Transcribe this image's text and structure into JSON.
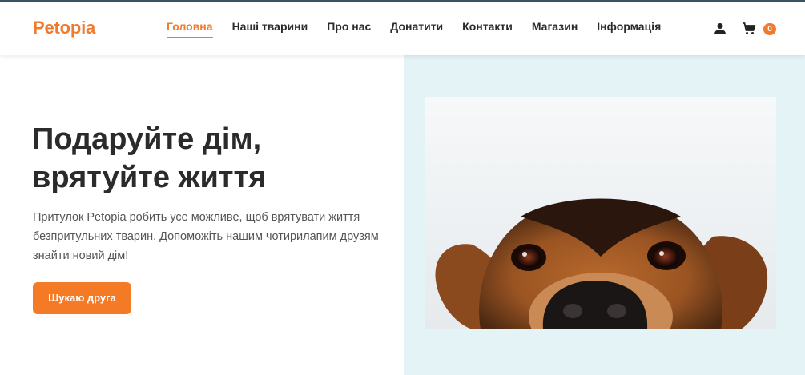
{
  "brand": {
    "name": "Petopia",
    "accent": "#f07a2e"
  },
  "nav": {
    "items": [
      {
        "label": "Головна",
        "active": true
      },
      {
        "label": "Наші тварини"
      },
      {
        "label": "Про нас"
      },
      {
        "label": "Донатити"
      },
      {
        "label": "Контакти"
      },
      {
        "label": "Магазин"
      },
      {
        "label": "Інформація"
      }
    ]
  },
  "header_icons": {
    "user": "user-icon",
    "cart": "cart-icon",
    "cart_count": "0"
  },
  "hero": {
    "title_line1": "Подаруйте дім,",
    "title_line2": "врятуйте життя",
    "description": "Притулок Petopia робить усе можливе, щоб врятувати життя безпритульних тварин. Допоможіть нашим чотирилапим друзям знайти новий дім!",
    "cta_label": "Шукаю друга",
    "image": "dog-peeking-photo",
    "right_panel_color": "#e3f3f6"
  }
}
